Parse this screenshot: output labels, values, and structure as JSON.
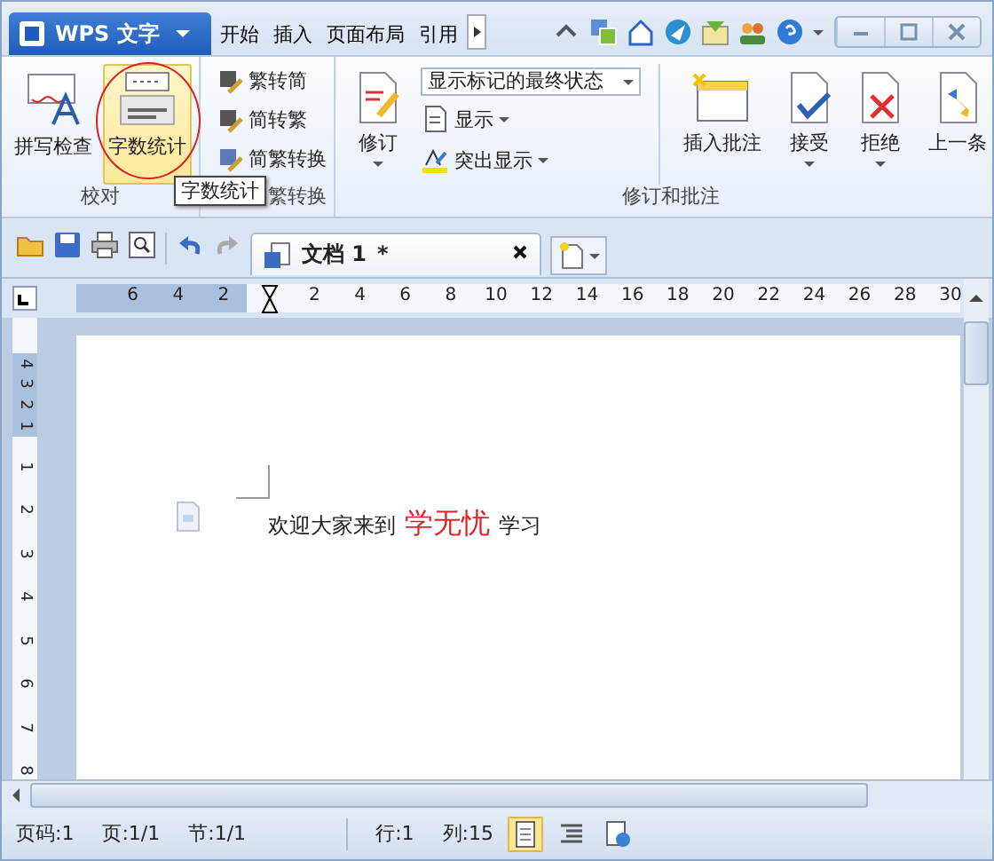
{
  "app_menu": {
    "label": "WPS 文字"
  },
  "menu_tabs": [
    {
      "label": "开始",
      "selected": false
    },
    {
      "label": "插入",
      "selected": false
    },
    {
      "label": "页面布局",
      "selected": false
    },
    {
      "label": "引用",
      "selected": false
    }
  ],
  "proofing": {
    "label": "校对",
    "buttons": [
      {
        "label": "拼写检查",
        "selected": false
      },
      {
        "label": "字数统计",
        "selected": true
      }
    ]
  },
  "chinese_conversion": {
    "label": "繁转换",
    "buttons": [
      "繁转简",
      "简转繁",
      "简繁转换"
    ]
  },
  "revision": {
    "label": "修订和批注",
    "track_button": "修订",
    "markup_dropdown": "显示标记的最终状态",
    "show_button": "显示",
    "highlight_button": "突出显示",
    "buttons": [
      {
        "label": "插入批注",
        "kind": "comment",
        "has_menu": false
      },
      {
        "label": "接受",
        "kind": "accept",
        "has_menu": true
      },
      {
        "label": "拒绝",
        "kind": "reject",
        "has_menu": true
      },
      {
        "label": "上一条",
        "kind": "previous",
        "has_menu": false
      }
    ]
  },
  "tooltip": "字数统计",
  "document_tab": {
    "title": "文档 1",
    "modified_mark": "*"
  },
  "ruler": {
    "left_numbers": [
      "6",
      "4",
      "2"
    ],
    "right_numbers": [
      "2",
      "4",
      "6",
      "8",
      "10",
      "12",
      "14",
      "16",
      "18",
      "20",
      "22",
      "24",
      "26",
      "28",
      "30"
    ]
  },
  "vertical_ruler": {
    "upper": [
      "4",
      "3",
      "2",
      "1"
    ],
    "lower": [
      "1",
      "2",
      "3",
      "4",
      "5",
      "6",
      "7",
      "8"
    ]
  },
  "document": {
    "runs": [
      {
        "text": "欢迎大家来到",
        "kind": "plain"
      },
      {
        "text": "学无忧",
        "kind": "red"
      },
      {
        "text": "学习",
        "kind": "plain"
      }
    ]
  },
  "status_bar": {
    "page_number": "页码:1",
    "pages": "页:1/1",
    "section": "节:1/1",
    "line": "行:1",
    "column": "列:15"
  }
}
